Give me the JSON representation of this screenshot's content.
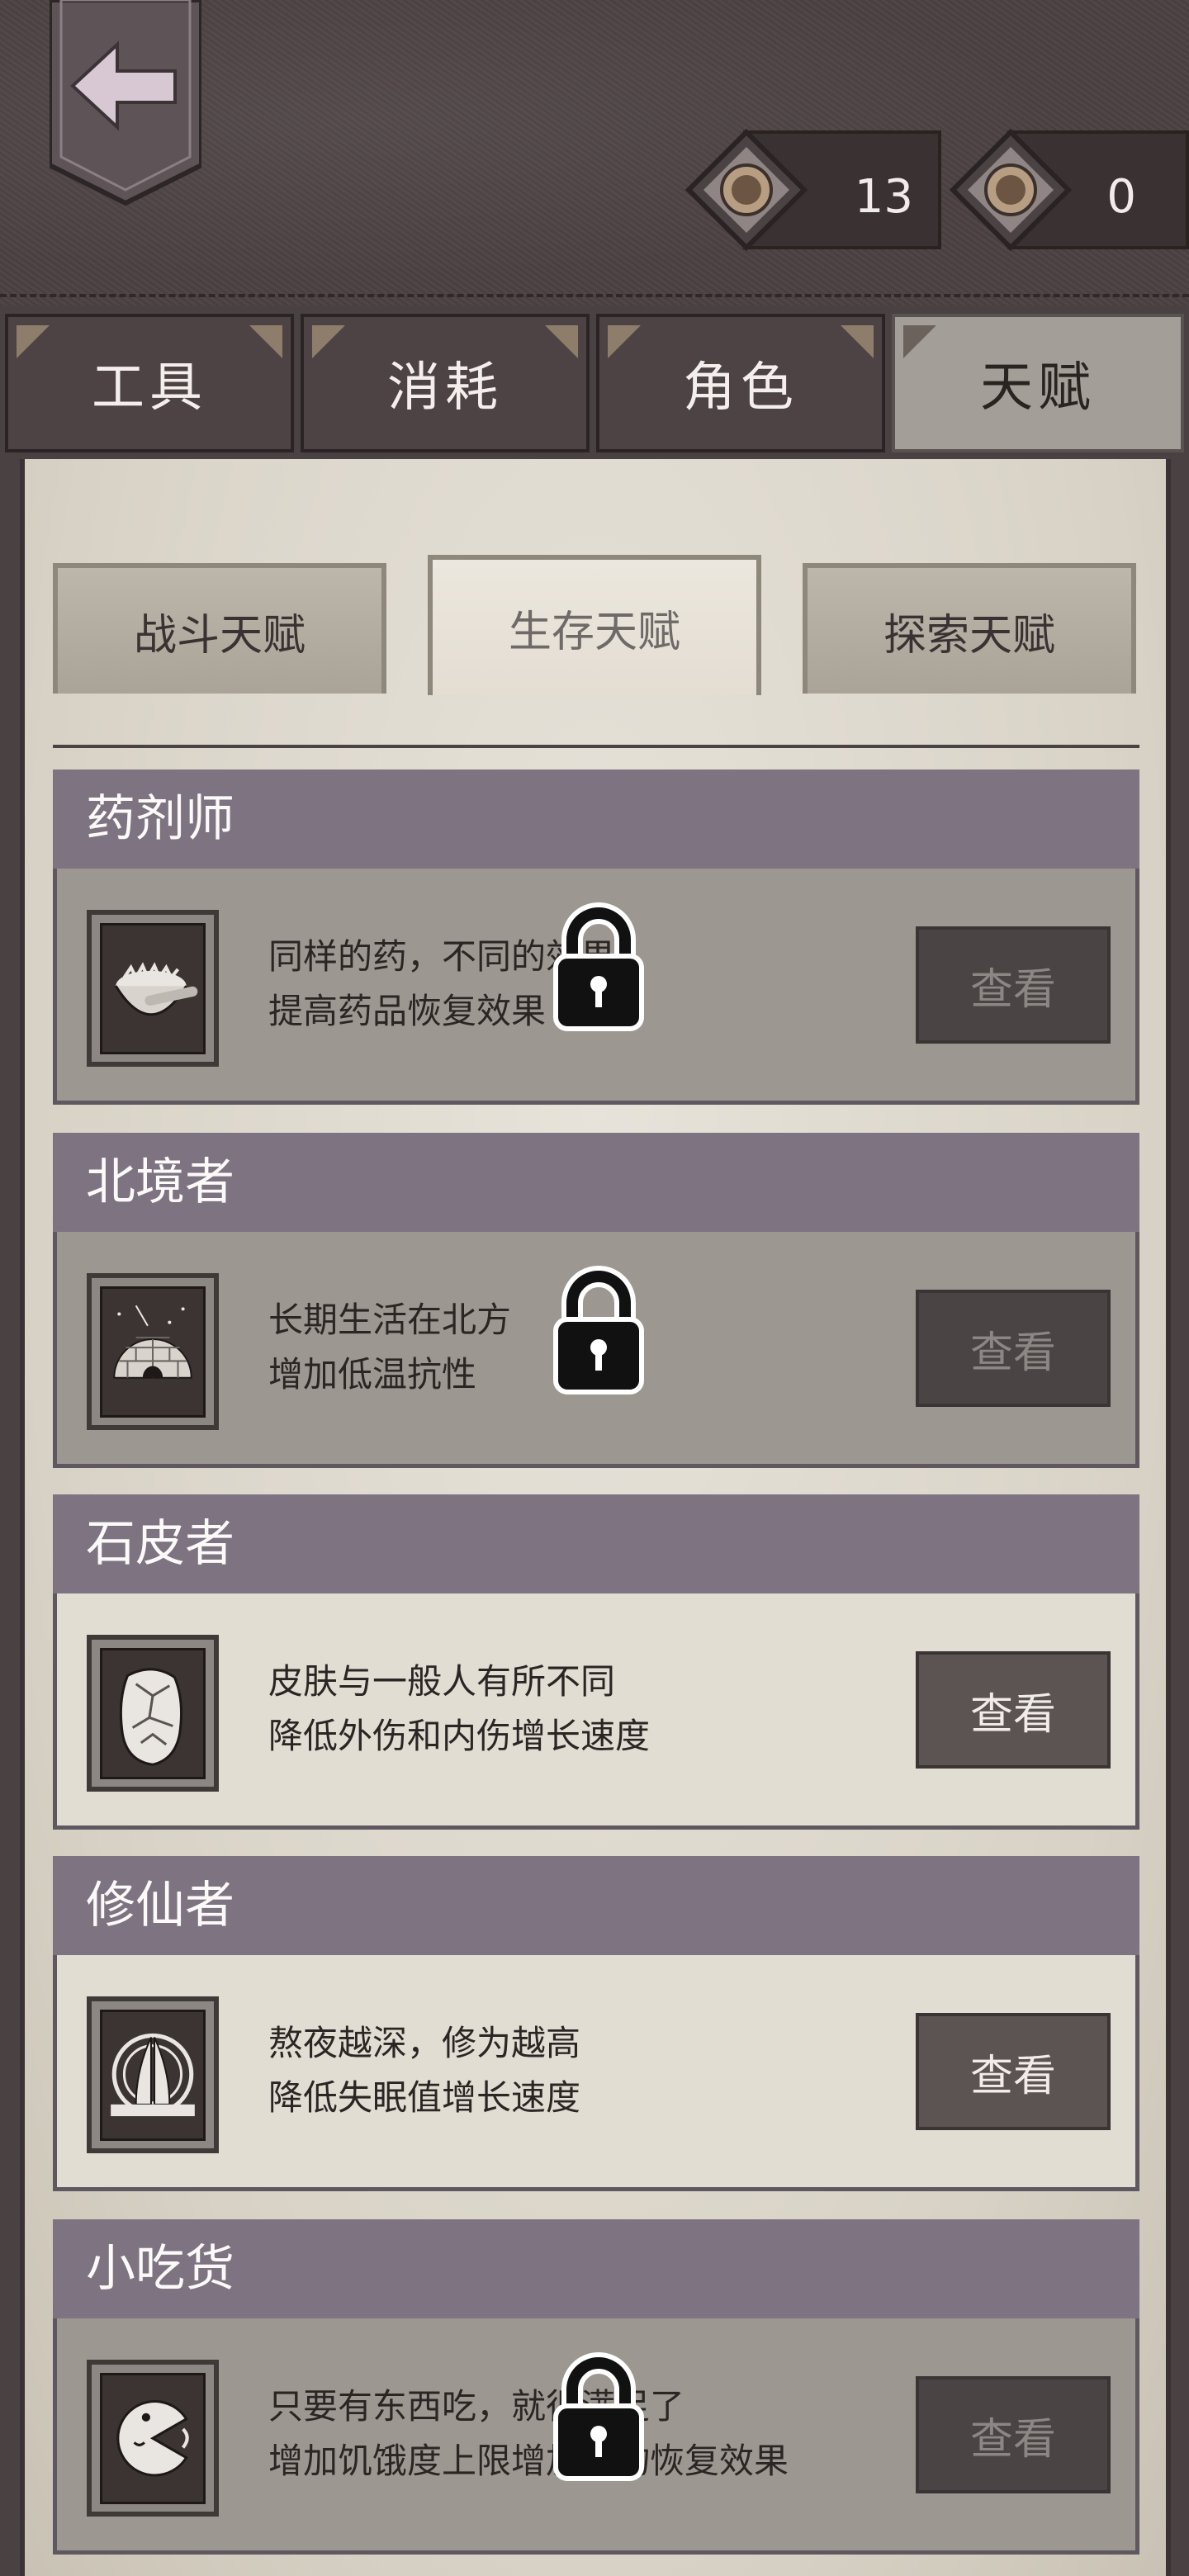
{
  "header": {
    "currency": [
      {
        "icon": "talent-coin-icon",
        "value": "13"
      },
      {
        "icon": "skill-coin-icon",
        "value": "0"
      }
    ]
  },
  "main_tabs": [
    {
      "label": "工具",
      "active": false
    },
    {
      "label": "消耗",
      "active": false
    },
    {
      "label": "角色",
      "active": false
    },
    {
      "label": "天赋",
      "active": true
    }
  ],
  "sub_tabs": [
    {
      "label": "战斗天赋",
      "active": false
    },
    {
      "label": "生存天赋",
      "active": true
    },
    {
      "label": "探索天赋",
      "active": false
    }
  ],
  "talents": [
    {
      "title": "药剂师",
      "line1": "同样的药，不同的效果",
      "line2": "提高药品恢复效果",
      "button": "查看",
      "locked": true,
      "icon": "mortar-pestle-icon"
    },
    {
      "title": "北境者",
      "line1": "长期生活在北方",
      "line2": "增加低温抗性",
      "button": "查看",
      "locked": true,
      "icon": "igloo-icon"
    },
    {
      "title": "石皮者",
      "line1": "皮肤与一般人有所不同",
      "line2": "降低外伤和内伤增长速度",
      "button": "查看",
      "locked": false,
      "icon": "stone-skin-icon"
    },
    {
      "title": "修仙者",
      "line1": "熬夜越深，修为越高",
      "line2": "降低失眠值增长速度",
      "button": "查看",
      "locked": false,
      "icon": "praying-hands-icon"
    },
    {
      "title": "小吃货",
      "line1": "只要有东西吃，就很满足了",
      "line2": "增加饥饿度上限增加食物恢复效果",
      "button": "查看",
      "locked": true,
      "icon": "pacman-eater-icon"
    }
  ]
}
